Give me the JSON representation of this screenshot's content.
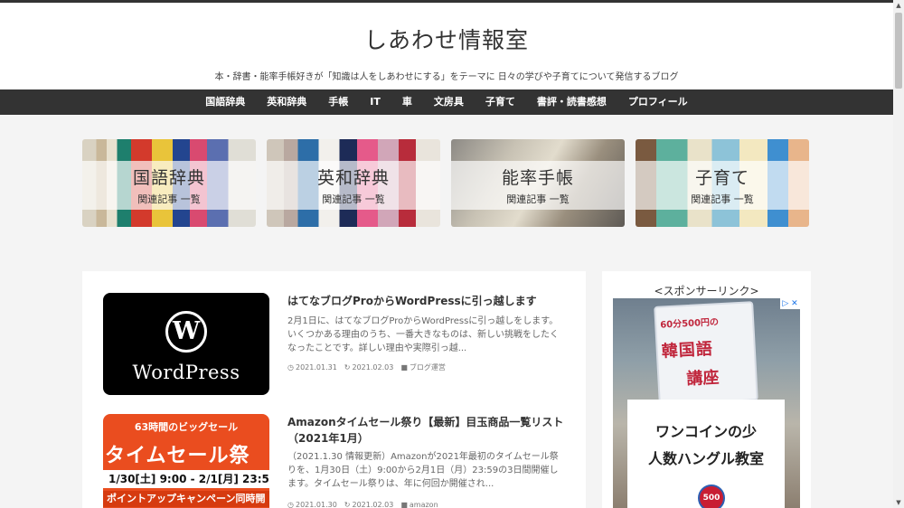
{
  "header": {
    "title": "しあわせ情報室",
    "description": "本・辞書・能率手帳好きが「知識は人をしあわせにする」をテーマに 日々の学びや子育てについて発信するブログ"
  },
  "nav": {
    "items": [
      {
        "label": "国語辞典"
      },
      {
        "label": "英和辞典"
      },
      {
        "label": "手帳"
      },
      {
        "label": "IT"
      },
      {
        "label": "車"
      },
      {
        "label": "文房具"
      },
      {
        "label": "子育て"
      },
      {
        "label": "書評・読書感想"
      },
      {
        "label": "プロフィール"
      }
    ]
  },
  "banners": [
    {
      "title": "国語辞典",
      "subtitle": "関連記事 一覧"
    },
    {
      "title": "英和辞典",
      "subtitle": "関連記事 一覧"
    },
    {
      "title": "能率手帳",
      "subtitle": "関連記事 一覧"
    },
    {
      "title": "子育て",
      "subtitle": "関連記事 一覧"
    }
  ],
  "posts": [
    {
      "title": "はてなブログProからWordPressに引っ越します",
      "excerpt": "2月1日に、はてなブログProからWordPressに引っ越しをします。いくつかある理由のうち、一番大きなものは、新しい挑戦をしたくなったことです。詳しい理由や実際引っ越...",
      "published": "2021.01.31",
      "updated": "2021.02.03",
      "category": "ブログ運営",
      "thumb_text": "WordPress",
      "thumb_logo": "W"
    },
    {
      "title": "Amazonタイムセール祭り【最新】目玉商品一覧リスト（2021年1月）",
      "excerpt": "（2021.1.30 情報更新）Amazonが2021年最初のタイムセール祭りを、1月30日（土）9:00から2月1日（月）23:59の3日間開催します。タイムセール祭りは、年に何回か開催され...",
      "published": "2021.01.30",
      "updated": "2021.02.03",
      "category": "amazon",
      "thumb_line1": "63時間のビッグセール",
      "thumb_line2": "タイムセール祭",
      "thumb_line3": "1/30[土] 9:00 - 2/1[月] 23:5",
      "thumb_line4": "ポイントアップキャンペーン同時開"
    }
  ],
  "sidebar": {
    "sponsor_label": "<スポンサーリンク>",
    "ad": {
      "sign_top": "60分500円の",
      "sign_mid": "韓国語",
      "sign_bottom": "講座",
      "line1": "ワンコインの少",
      "line2": "人数ハングル教室",
      "badge": "500"
    }
  },
  "colors": {
    "nav_bg": "#333333",
    "page_bg": "#f4f4f4",
    "sale_orange": "#ea4d1f"
  }
}
